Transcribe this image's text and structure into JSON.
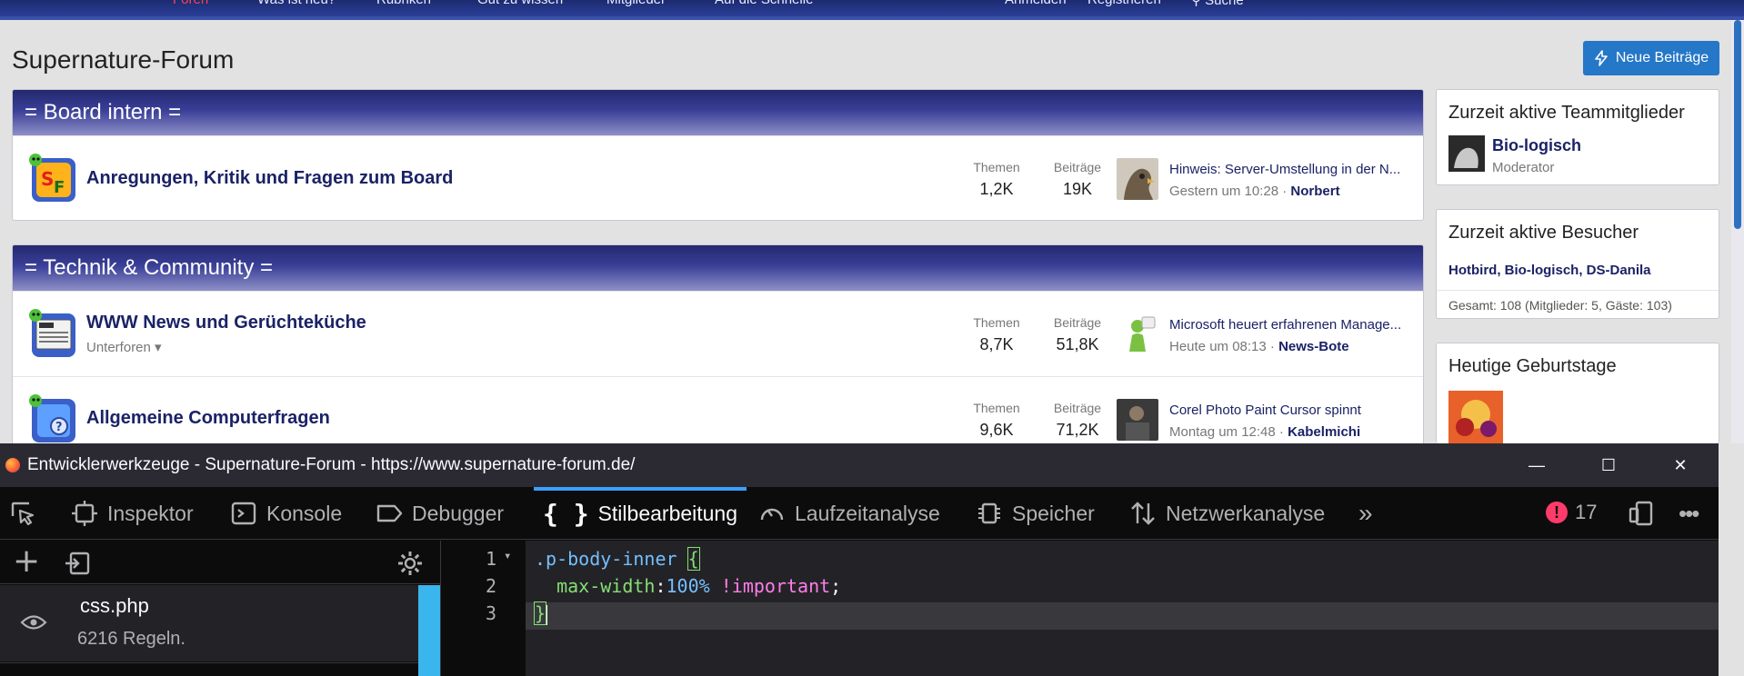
{
  "topnav": {
    "items": [
      "Foren",
      "Was ist neu?",
      "Rubriken",
      "Gut zu wissen",
      "Mitglieder",
      "Auf die Schnelle"
    ],
    "login": "Anmelden",
    "register": "Registrieren",
    "search": "Suche"
  },
  "page": {
    "title": "Supernature-Forum",
    "new_posts_button": "Neue Beiträge"
  },
  "categories": [
    {
      "title": "= Board intern =",
      "nodes": [
        {
          "title": "Anregungen, Kritik und Fragen zum Board",
          "sub": "",
          "themen_label": "Themen",
          "themen": "1,2K",
          "beitraege_label": "Beiträge",
          "beitraege": "19K",
          "last_title": "Hinweis: Server-Umstellung in der N...",
          "last_time": "Gestern um 10:28",
          "last_user": "Norbert"
        }
      ]
    },
    {
      "title": "= Technik & Community =",
      "nodes": [
        {
          "title": "WWW News und Gerüchteküche",
          "sub": "Unterforen",
          "themen_label": "Themen",
          "themen": "8,7K",
          "beitraege_label": "Beiträge",
          "beitraege": "51,8K",
          "last_title": "Microsoft heuert erfahrenen Manage...",
          "last_time": "Heute um 08:13",
          "last_user": "News-Bote"
        },
        {
          "title": "Allgemeine Computerfragen",
          "sub": "",
          "themen_label": "Themen",
          "themen": "9,6K",
          "beitraege_label": "Beiträge",
          "beitraege": "71,2K",
          "last_title": "Corel Photo Paint Cursor spinnt",
          "last_time": "Montag um 12:48",
          "last_user": "Kabelmichi"
        }
      ]
    }
  ],
  "sidebar": {
    "team": {
      "title": "Zurzeit aktive Teammitglieder",
      "name": "Bio-logisch",
      "role": "Moderator"
    },
    "visitors": {
      "title": "Zurzeit aktive Besucher",
      "names": "Hotbird, Bio-logisch, DS-Danila",
      "total": "Gesamt: 108 (Mitglieder: 5, Gäste: 103)"
    },
    "birthdays": {
      "title": "Heutige Geburtstage"
    }
  },
  "devtools": {
    "window_title": "Entwicklerwerkzeuge - Supernature-Forum - https://www.supernature-forum.de/",
    "tabs": [
      "Inspektor",
      "Konsole",
      "Debugger",
      "Stilbearbeitung",
      "Laufzeitanalyse",
      "Speicher",
      "Netzwerkanalyse"
    ],
    "selected_tab": "Stilbearbeitung",
    "error_count": "17",
    "stylesheet": {
      "name": "css.php",
      "rules": "6216 Regeln."
    },
    "code": {
      "line_numbers": [
        "1",
        "2",
        "3"
      ],
      "selector": ".p-body-inner",
      "open_brace": "{",
      "property": "max-width",
      "colon": ":",
      "value": "100%",
      "important": "!important",
      "semicolon": ";",
      "close_brace": "}"
    }
  },
  "colors": {
    "accent": "#2577c8",
    "header_dark": "#23286f",
    "link": "#1a2266",
    "devtools_tab_highlight": "#3aa0ff"
  }
}
